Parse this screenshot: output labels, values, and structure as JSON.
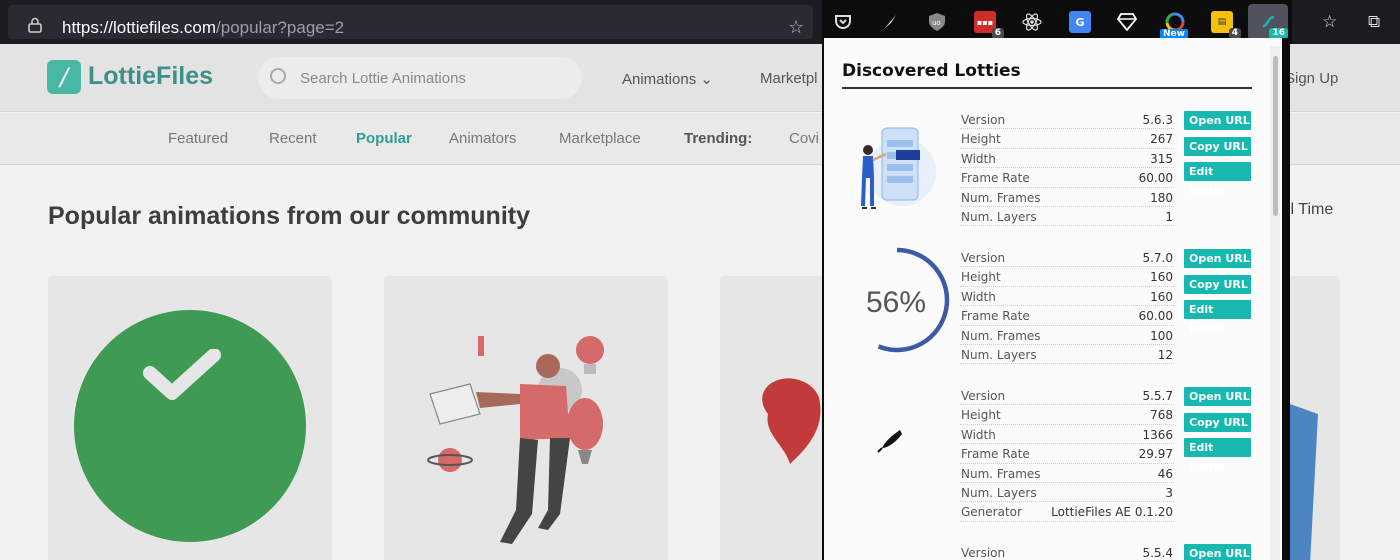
{
  "browser": {
    "url_host": "https://lottiefiles.com",
    "url_path": "/popular?page=2",
    "extensions": [
      {
        "icon": "pocket-icon"
      },
      {
        "icon": "quill-icon"
      },
      {
        "icon": "ublock-icon"
      },
      {
        "icon": "red-ext-icon",
        "badge": "6"
      },
      {
        "icon": "react-icon"
      },
      {
        "icon": "translate-icon"
      },
      {
        "icon": "diamond-icon"
      },
      {
        "icon": "color-ext-icon",
        "badge": "New"
      },
      {
        "icon": "note-ext-icon",
        "badge": "4"
      },
      {
        "icon": "lottie-ext-icon",
        "badge": "16"
      }
    ]
  },
  "site": {
    "logo": "LottieFiles",
    "search_placeholder": "Search Lottie Animations",
    "nav": {
      "animations": "Animations",
      "marketplace": "Marketpl",
      "signup": "Sign Up"
    },
    "subnav": [
      "Featured",
      "Recent",
      "Popular",
      "Animators",
      "Marketplace",
      "Trending:",
      "Covi"
    ],
    "heading": "Popular animations from our community",
    "filter": "ll Time"
  },
  "popup": {
    "title": "Discovered Lotties",
    "buttons": {
      "open": "Open URL",
      "copy": "Copy URL",
      "edit": "Edit Lottie"
    },
    "entries": [
      {
        "thumb": "phone-app-illustration",
        "props": [
          {
            "k": "Version",
            "v": "5.6.3"
          },
          {
            "k": "Height",
            "v": "267"
          },
          {
            "k": "Width",
            "v": "315"
          },
          {
            "k": "Frame Rate",
            "v": "60.00"
          },
          {
            "k": "Num. Frames",
            "v": "180"
          },
          {
            "k": "Num. Layers",
            "v": "1"
          }
        ]
      },
      {
        "thumb": "progress-ring",
        "percent": "56%",
        "props": [
          {
            "k": "Version",
            "v": "5.7.0"
          },
          {
            "k": "Height",
            "v": "160"
          },
          {
            "k": "Width",
            "v": "160"
          },
          {
            "k": "Frame Rate",
            "v": "60.00"
          },
          {
            "k": "Num. Frames",
            "v": "100"
          },
          {
            "k": "Num. Layers",
            "v": "12"
          }
        ]
      },
      {
        "thumb": "feather-pen",
        "props": [
          {
            "k": "Version",
            "v": "5.5.7"
          },
          {
            "k": "Height",
            "v": "768"
          },
          {
            "k": "Width",
            "v": "1366"
          },
          {
            "k": "Frame Rate",
            "v": "29.97"
          },
          {
            "k": "Num. Frames",
            "v": "46"
          },
          {
            "k": "Num. Layers",
            "v": "3"
          },
          {
            "k": "Generator",
            "v": "LottieFiles AE 0.1.20"
          }
        ]
      },
      {
        "thumb": "unknown",
        "props": [
          {
            "k": "Version",
            "v": "5.5.4"
          }
        ]
      }
    ]
  }
}
